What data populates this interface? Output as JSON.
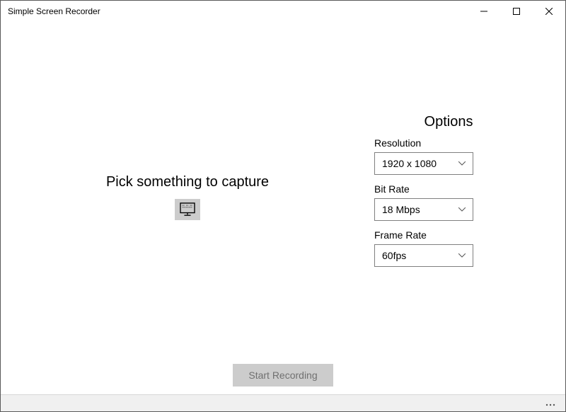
{
  "window": {
    "title": "Simple Screen Recorder"
  },
  "capture": {
    "heading": "Pick something to capture"
  },
  "options": {
    "heading": "Options",
    "resolution": {
      "label": "Resolution",
      "value": "1920 x 1080"
    },
    "bitrate": {
      "label": "Bit Rate",
      "value": "18 Mbps"
    },
    "framerate": {
      "label": "Frame Rate",
      "value": "60fps"
    }
  },
  "actions": {
    "start": "Start Recording"
  }
}
